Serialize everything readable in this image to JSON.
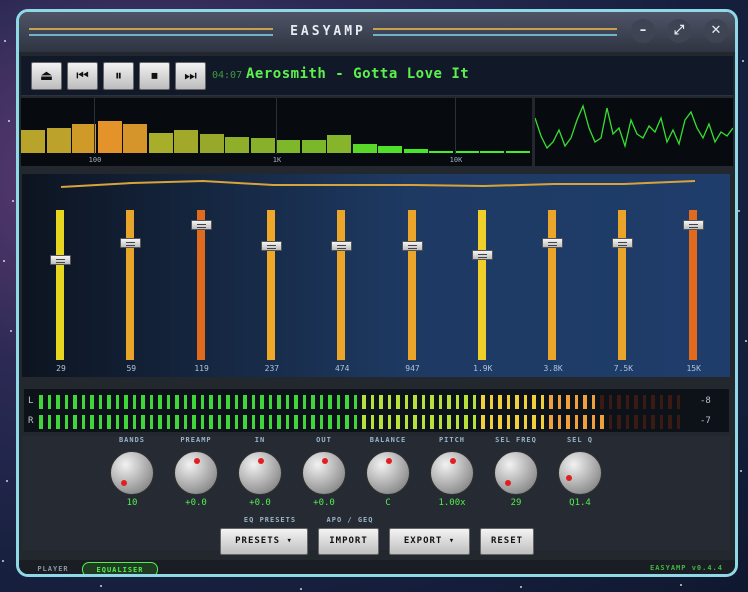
{
  "window": {
    "title": "EASYAMP",
    "minimize_icon": "minus-icon",
    "maximize_icon": "expand-icon",
    "close_icon": "close-icon"
  },
  "transport": {
    "buttons": [
      "eject-icon",
      "previous-icon",
      "pause-icon",
      "stop-icon",
      "next-icon"
    ],
    "time": "04:07",
    "track": "Aerosmith - Gotta Love It"
  },
  "spectrum": {
    "ticks": [
      "100",
      "1K",
      "10K"
    ],
    "levels": [
      0.42,
      0.45,
      0.52,
      0.58,
      0.53,
      0.37,
      0.41,
      0.35,
      0.3,
      0.28,
      0.24,
      0.24,
      0.32,
      0.16,
      0.12,
      0.08,
      0.03,
      0.03,
      0.02,
      0.02
    ]
  },
  "eq": {
    "bands": [
      {
        "label": "29",
        "value": 0.33,
        "color": "#e6d61f"
      },
      {
        "label": "59",
        "value": 0.22,
        "color": "#e9a52a"
      },
      {
        "label": "119",
        "value": 0.1,
        "color": "#e26a1c"
      },
      {
        "label": "237",
        "value": 0.24,
        "color": "#f0a828"
      },
      {
        "label": "474",
        "value": 0.24,
        "color": "#eaa52a"
      },
      {
        "label": "947",
        "value": 0.24,
        "color": "#eaa52a"
      },
      {
        "label": "1.9K",
        "value": 0.3,
        "color": "#f1cf2a"
      },
      {
        "label": "3.8K",
        "value": 0.22,
        "color": "#eaa52a"
      },
      {
        "label": "7.5K",
        "value": 0.22,
        "color": "#e9a52a"
      },
      {
        "label": "15K",
        "value": 0.1,
        "color": "#e26a1c"
      }
    ]
  },
  "meters": {
    "left_label": "L",
    "right_label": "R",
    "left_value": "-8",
    "right_value": "-7",
    "left_level": 0.86,
    "right_level": 0.87
  },
  "knobs": [
    {
      "label": "BANDS",
      "value": "10",
      "angle": 225
    },
    {
      "label": "PREAMP",
      "value": "+0.0",
      "angle": 0
    },
    {
      "label": "IN",
      "value": "+0.0",
      "angle": 0
    },
    {
      "label": "OUT",
      "value": "+0.0",
      "angle": 0
    },
    {
      "label": "BALANCE",
      "value": "C",
      "angle": 0
    },
    {
      "label": "PITCH",
      "value": "1.00x",
      "angle": 0
    },
    {
      "label": "SEL FREQ",
      "value": "29",
      "angle": 225
    },
    {
      "label": "SEL Q",
      "value": "Q1.4",
      "angle": 250
    }
  ],
  "actions": {
    "eq_presets_label": "EQ PRESETS",
    "apo_label": "APO / GEQ",
    "presets": "PRESETS",
    "import": "IMPORT",
    "export": "EXPORT",
    "reset": "RESET",
    "dropdown_icon": "caret-down-icon"
  },
  "footer": {
    "tabs": [
      "PLAYER",
      "EQUALISER"
    ],
    "active_tab": "EQUALISER",
    "version": "EASYAMP v0.4.4"
  },
  "colors": {
    "accent": "#5cf24e",
    "frame": "#8fd8e6"
  }
}
